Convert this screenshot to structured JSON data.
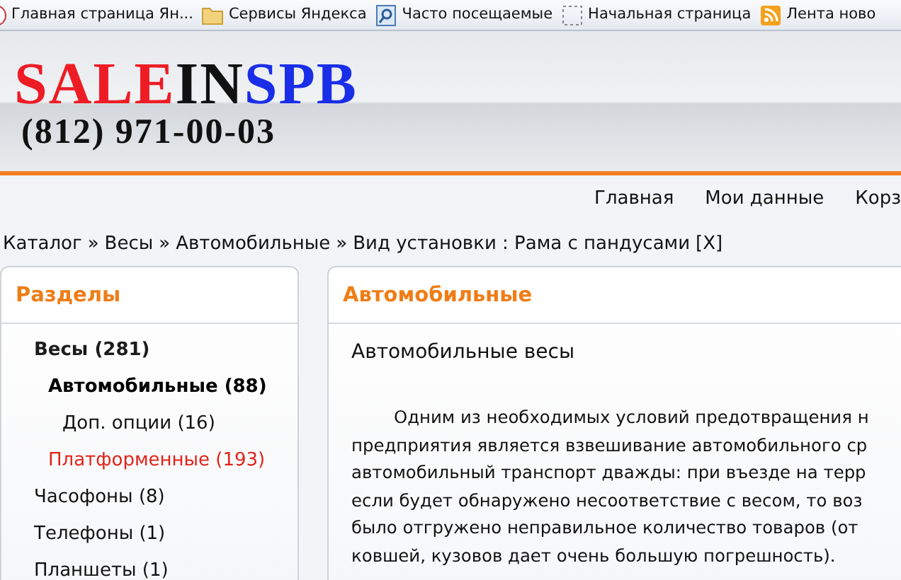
{
  "bookmarks_bar": [
    {
      "label": "Главная страница Ян..."
    },
    {
      "label": "Сервисы Яндекса"
    },
    {
      "label": "Часто посещаемые"
    },
    {
      "label": "Начальная страница"
    },
    {
      "label": "Лента ново"
    }
  ],
  "logo": [
    {
      "text": "SALE",
      "color": "#ee1c25"
    },
    {
      "text": "IN",
      "color": "#111111"
    },
    {
      "text": "SPB",
      "color": "#1a2ee8"
    }
  ],
  "phone": "(812) 971-00-03",
  "nav": [
    "Главная",
    "Мои данные",
    "Корз"
  ],
  "breadcrumb": {
    "items": [
      "Каталог",
      "Весы",
      "Автомобильные"
    ],
    "separator": "»",
    "filter": "Вид установки : Рама с пандусами",
    "remove": "[X]"
  },
  "sidebar": {
    "title": "Разделы",
    "items": [
      {
        "label": "Весы (281)",
        "selected": false,
        "expanded": true,
        "highlighted": false,
        "children": [
          {
            "label": "Автомобильные (88)",
            "selected": true,
            "highlighted": false,
            "children": [
              {
                "label": "Доп. опции (16)",
                "selected": false,
                "highlighted": false
              }
            ]
          },
          {
            "label": "Платформенные (193)",
            "selected": false,
            "highlighted": true
          }
        ]
      },
      {
        "label": "Часофоны (8)",
        "selected": false,
        "highlighted": false
      },
      {
        "label": "Телефоны (1)",
        "selected": false,
        "highlighted": false
      },
      {
        "label": "Планшеты (1)",
        "selected": false,
        "highlighted": false
      }
    ]
  },
  "content": {
    "title": "Автомобильные",
    "subtitle": "Автомобильные весы",
    "paragraph_lines": [
      "Одним из необходимых условий предотвращения н",
      "предприятия является взвешивание автомобильного ср",
      "автомобильный транспорт дважды: при въезде на терр",
      "если будет обнаружено несоответствие с весом, то воз",
      "было отгружено неправильное количество товаров (от",
      "ковшей, кузовов дает очень большую погрешность)."
    ]
  }
}
